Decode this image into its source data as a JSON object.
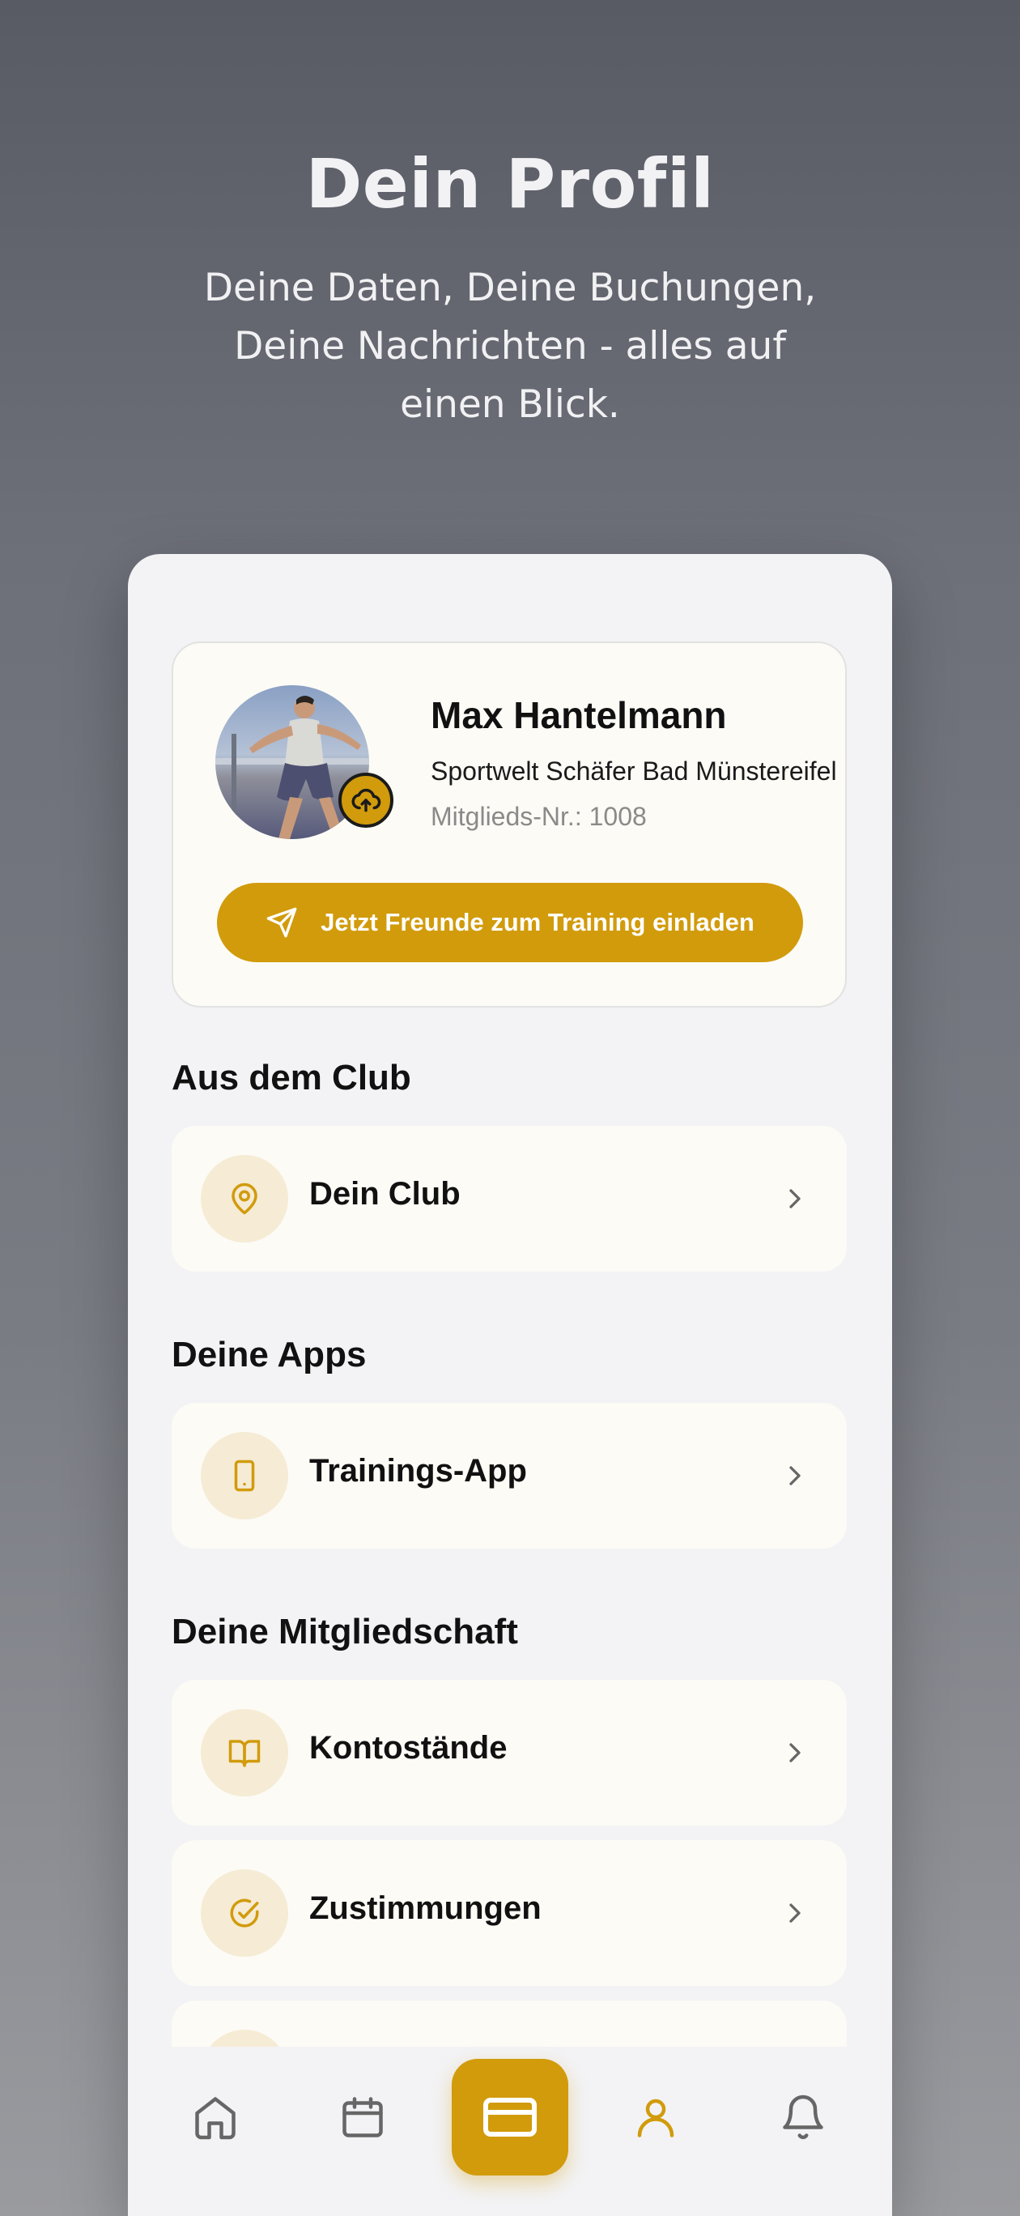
{
  "hero": {
    "title": "Dein Profil",
    "subtitle": "Deine Daten, Deine Buchungen, Deine Nachrichten - alles auf einen Blick."
  },
  "profile": {
    "name": "Max Hantelmann",
    "club": "Sportwelt Schäfer Bad Münstereifel",
    "member_no": "Mitglieds-Nr.: 1008",
    "invite_label": "Jetzt Freunde zum Training einladen"
  },
  "sections": {
    "club": {
      "title": "Aus dem Club",
      "items": [
        {
          "label": "Dein Club",
          "icon": "map-pin-icon"
        }
      ]
    },
    "apps": {
      "title": "Deine Apps",
      "items": [
        {
          "label": "Trainings-App",
          "icon": "smartphone-icon"
        }
      ]
    },
    "membership": {
      "title": "Deine Mitgliedschaft",
      "items": [
        {
          "label": "Kontostände",
          "icon": "book-open-icon"
        },
        {
          "label": "Zustimmungen",
          "icon": "check-circle-icon"
        }
      ]
    }
  },
  "tabbar": {
    "items": [
      {
        "name": "home",
        "icon": "home-icon",
        "active": false
      },
      {
        "name": "calendar",
        "icon": "calendar-icon",
        "active": false
      },
      {
        "name": "card",
        "icon": "credit-card-icon",
        "active": false,
        "highlighted": true
      },
      {
        "name": "profile",
        "icon": "user-icon",
        "active": true
      },
      {
        "name": "notifications",
        "icon": "bell-icon",
        "active": false
      }
    ]
  },
  "colors": {
    "accent": "#d19b0c",
    "icon_bg": "#f6ebd4",
    "card_bg": "#fcfbf6",
    "screen_bg": "#f3f3f5"
  }
}
